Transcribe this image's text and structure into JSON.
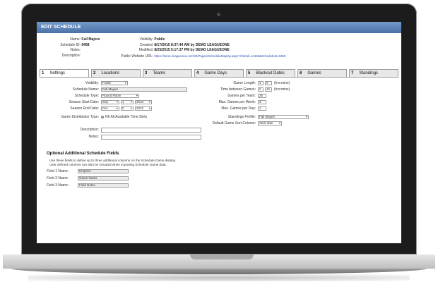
{
  "window": {
    "title": "EDIT SCHEDULE"
  },
  "info_left": [
    {
      "label": "Name:",
      "value": "Fall Majors"
    },
    {
      "label": "Schedule ID:",
      "value": "9458"
    },
    {
      "label": "Notes:",
      "value": ""
    },
    {
      "label": "Description:",
      "value": ""
    }
  ],
  "info_right": [
    {
      "label": "Visibility:",
      "value": "Public"
    },
    {
      "label": "Created:",
      "value": "8/17/2015 8:37:44 AM by DEMO LEAGUEONE"
    },
    {
      "label": "Modified:",
      "value": "8/25/2015 5:17:37 PM by DEMO LEAGUEONE"
    },
    {
      "label": "Public Website URL:",
      "value": "https://demo.leagueone.com/Ol/Pages/ScheduleDisplay.aspx?ClubId=14495&ScheduleId=9458"
    }
  ],
  "tabs": [
    {
      "num": "1",
      "label": "Settings"
    },
    {
      "num": "2",
      "label": "Locations"
    },
    {
      "num": "3",
      "label": "Teams"
    },
    {
      "num": "4",
      "label": "Game Days"
    },
    {
      "num": "5",
      "label": "Blackout Dates"
    },
    {
      "num": "6",
      "label": "Games"
    },
    {
      "num": "7",
      "label": "Standings"
    }
  ],
  "settings": {
    "visibility_label": "Visibility:",
    "visibility_value": "Public",
    "name_label": "Schedule Name:",
    "name_value": "Fall Majors",
    "type_label": "Schedule Type:",
    "type_value": "Round Robin",
    "start_label": "Season Start Date:",
    "start_month": "Sep",
    "start_day": "1",
    "start_year": "2015",
    "end_label": "Season End Date:",
    "end_month": "Dec",
    "end_day": "5",
    "end_year": "2015",
    "dist_label": "Game Distribution Type:",
    "dist_value": "Fill All Available Time Slots",
    "desc_label": "Description:",
    "desc_value": "",
    "notes_label": "Notes:",
    "notes_value": "",
    "length_label": "Game Length:",
    "length_h": "1",
    "length_m": "0",
    "length_unit": "(hrs:mins)",
    "between_label": "Time between Games:",
    "between_h": "0",
    "between_m": "15",
    "between_unit": "(hrs:mins)",
    "per_team_label": "Games per Team:",
    "per_team_value": "25",
    "per_week_label": "Max. Games per Week:",
    "per_week_value": "3",
    "per_day_label": "Max. Games per Day:",
    "per_day_value": "1",
    "profile_label": "Standings Profile:",
    "profile_value": "Fall Majors",
    "sort_label": "Default Game Sort Column:",
    "sort_value": "Start date"
  },
  "optional": {
    "title": "Optional Additional Schedule Fields",
    "help1": "Use these fields to define up to three additional columns on the Schedule Game display.",
    "help2": "User defined columns can also be included when importing Schedule Game data.",
    "fields": [
      {
        "label": "Field 1 Name:",
        "value": "Umpires"
      },
      {
        "label": "Field 2 Name:",
        "value": "Game Notes"
      },
      {
        "label": "Field 3 Name:",
        "value": "Field Notes"
      }
    ]
  }
}
